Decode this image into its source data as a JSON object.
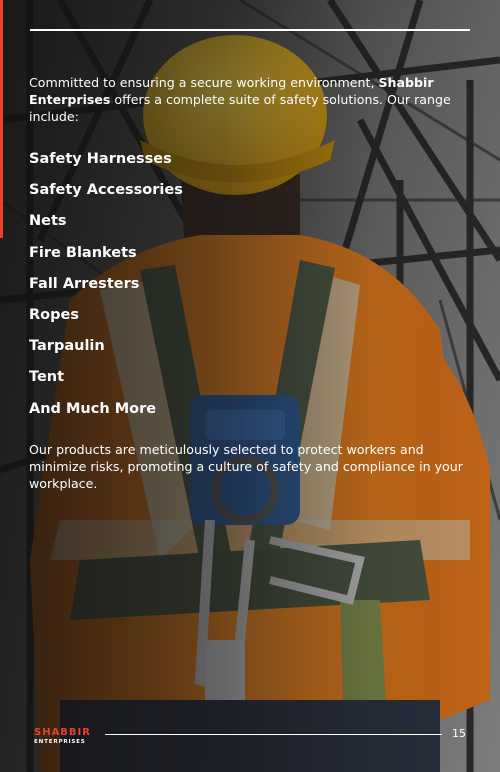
{
  "intro": {
    "text_before": "Committed to ensuring a secure working environment, ",
    "company": "Shabbir Enterprises",
    "text_after": " offers a complete suite of safety solutions.  Our range include:"
  },
  "products": [
    "Safety Harnesses",
    "Safety Accessories",
    "Nets",
    "Fire Blankets",
    "Fall Arresters",
    "Ropes",
    "Tarpaulin",
    "Tent",
    "And Much More"
  ],
  "outro": "Our products are meticulously selected to protect workers and minimize risks, promoting a culture of safety and compliance in your workplace.",
  "footer": {
    "logo_name": "SHABBIR",
    "logo_sub": "ENTERPRISES",
    "page_number": "15"
  },
  "colors": {
    "accent": "#e8422c",
    "vest": "#f07d1a",
    "helmet": "#f4c419",
    "harness_buckle": "#2e5f9e",
    "text": "#ffffff"
  }
}
